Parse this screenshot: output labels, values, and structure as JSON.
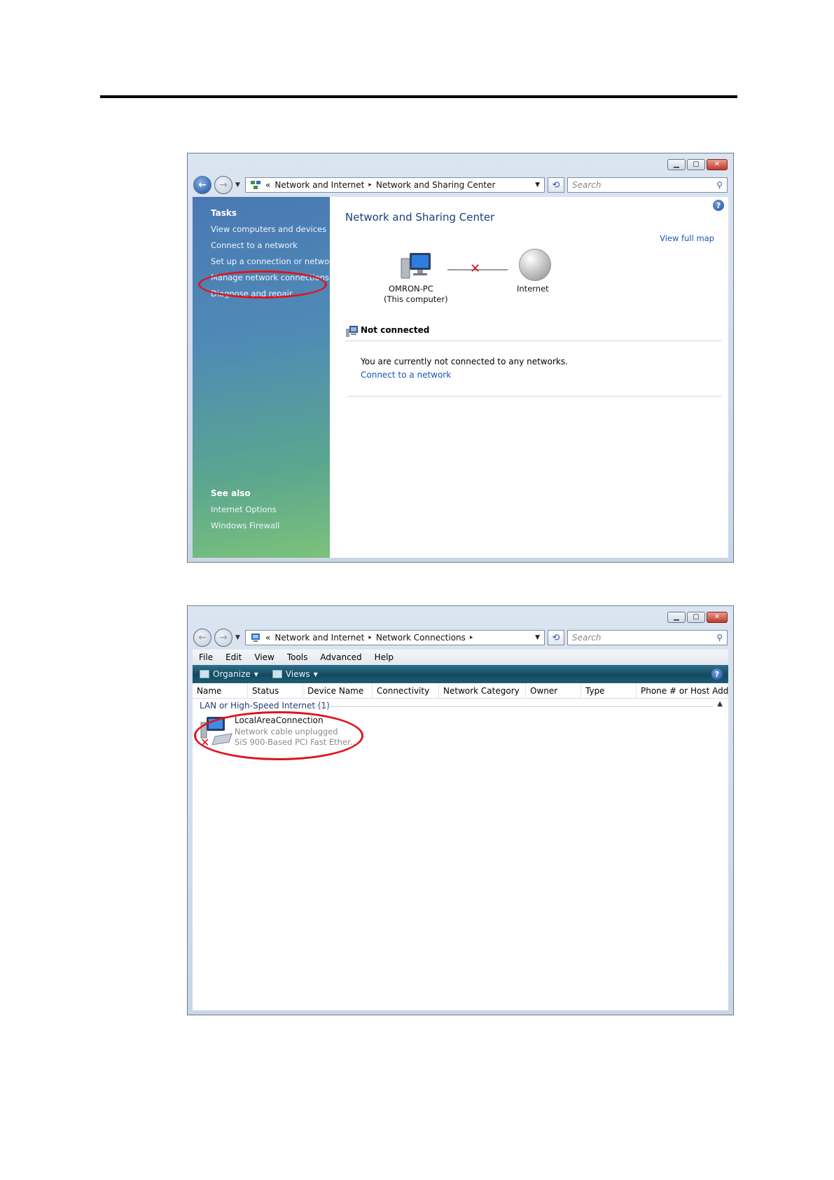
{
  "window1": {
    "address": {
      "prefix": "«",
      "crumb1": "Network and Internet",
      "sep": "▸",
      "crumb2": "Network and Sharing Center"
    },
    "search_placeholder": "Search",
    "sidebar": {
      "tasks_heading": "Tasks",
      "items": [
        "View computers and devices",
        "Connect to a network",
        "Set up a connection or network",
        "Manage network connections",
        "Diagnose and repair"
      ],
      "see_also_heading": "See also",
      "see_also": [
        "Internet Options",
        "Windows Firewall"
      ]
    },
    "content": {
      "title": "Network and Sharing Center",
      "view_full_map": "View full map",
      "computer_name": "OMRON-PC",
      "computer_sub": "(This computer)",
      "internet_label": "Internet",
      "status_title": "Not connected",
      "message": "You are currently not connected to any networks.",
      "connect_link": "Connect to a network"
    }
  },
  "window2": {
    "address": {
      "prefix": "«",
      "crumb1": "Network and Internet",
      "sep": "▸",
      "crumb2": "Network Connections",
      "trail": "▸"
    },
    "search_placeholder": "Search",
    "menu": [
      "File",
      "Edit",
      "View",
      "Tools",
      "Advanced",
      "Help"
    ],
    "toolbar": {
      "organize": "Organize",
      "views": "Views"
    },
    "columns": [
      "Name",
      "Status",
      "Device Name",
      "Connectivity",
      "Network Category",
      "Owner",
      "Type",
      "Phone # or Host Addre..."
    ],
    "group_label": "LAN or High-Speed Internet (1)",
    "connection": {
      "name": "LocalAreaConnection",
      "status": "Network cable unplugged",
      "device": "SiS 900-Based PCI Fast Ether..."
    }
  },
  "colors": {
    "highlight": "#e0141b",
    "link": "#1a56b4",
    "title_blue": "#1d3d7a"
  }
}
